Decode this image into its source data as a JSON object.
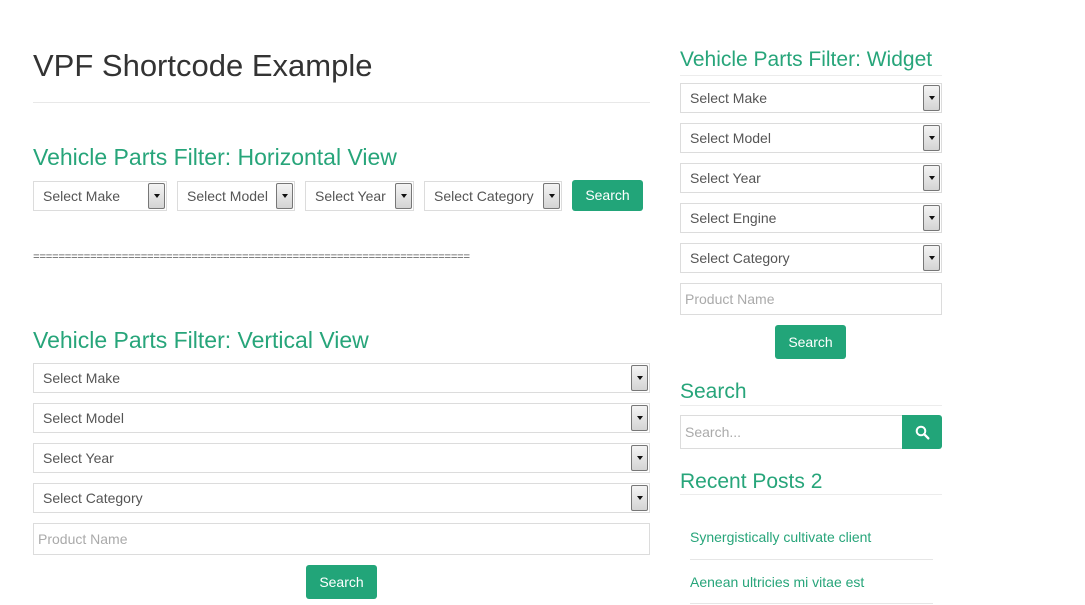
{
  "main": {
    "page_title": "VPF Shortcode Example",
    "horizontal": {
      "heading": "Vehicle Parts Filter: Horizontal View",
      "selects": [
        "Select Make",
        "Select Model",
        "Select Year",
        "Select Category"
      ],
      "search_label": "Search"
    },
    "separator": "=====================================================================",
    "vertical": {
      "heading": "Vehicle Parts Filter: Vertical View",
      "selects": [
        "Select Make",
        "Select Model",
        "Select Year",
        "Select Category"
      ],
      "product_placeholder": "Product Name",
      "search_label": "Search"
    }
  },
  "sidebar": {
    "widget": {
      "heading": "Vehicle Parts Filter: Widget",
      "selects": [
        "Select Make",
        "Select Model",
        "Select Year",
        "Select Engine",
        "Select Category"
      ],
      "product_placeholder": "Product Name",
      "search_label": "Search"
    },
    "search": {
      "heading": "Search",
      "placeholder": "Search...",
      "icon": "search-icon"
    },
    "recent_posts": {
      "heading": "Recent Posts 2",
      "items": [
        "Synergistically cultivate client",
        "Aenean ultricies mi vitae est"
      ]
    }
  },
  "colors": {
    "accent": "#22a579",
    "heading": "#27a57a",
    "text": "#555555"
  }
}
